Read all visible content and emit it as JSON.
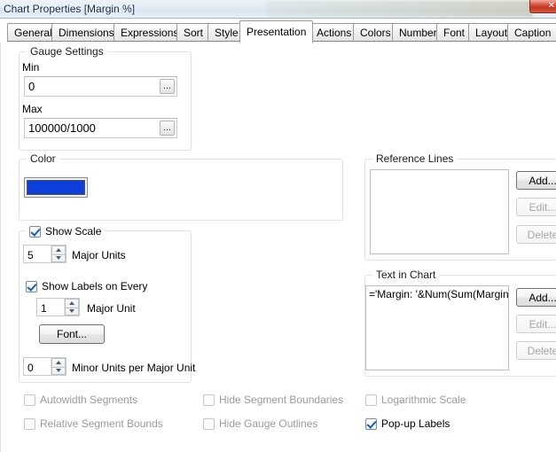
{
  "window": {
    "title": "Chart Properties [Margin %]",
    "close_label": "✕"
  },
  "tabs": [
    {
      "label": "General",
      "active": false
    },
    {
      "label": "Dimensions",
      "active": false
    },
    {
      "label": "Expressions",
      "active": false
    },
    {
      "label": "Sort",
      "active": false
    },
    {
      "label": "Style",
      "active": false
    },
    {
      "label": "Presentation",
      "active": true
    },
    {
      "label": "Actions",
      "active": false
    },
    {
      "label": "Colors",
      "active": false
    },
    {
      "label": "Number",
      "active": false
    },
    {
      "label": "Font",
      "active": false
    },
    {
      "label": "Layout",
      "active": false
    },
    {
      "label": "Caption",
      "active": false
    }
  ],
  "gauge_settings": {
    "title": "Gauge Settings",
    "min_label": "Min",
    "min_value": "0",
    "max_label": "Max",
    "max_value": "100000/1000",
    "ellipsis_label": "..."
  },
  "color_group": {
    "title": "Color",
    "swatch_color": "#0d3fdb"
  },
  "scale_group": {
    "show_scale_label": "Show Scale",
    "show_scale_checked": true,
    "major_units_value": "5",
    "major_units_label": "Major Units",
    "show_labels_label": "Show Labels on Every",
    "show_labels_checked": true,
    "major_unit_value": "1",
    "major_unit_label": "Major Unit",
    "font_button_label": "Font...",
    "minor_units_value": "0",
    "minor_units_label": "Minor Units per Major Unit"
  },
  "reference_lines": {
    "title": "Reference Lines",
    "items": [],
    "add_label": "Add...",
    "edit_label": "Edit...",
    "delete_label": "Delete"
  },
  "text_in_chart": {
    "title": "Text in Chart",
    "items": [
      "='Margin: '&Num(Sum(Margin) / S"
    ],
    "add_label": "Add...",
    "edit_label": "Edit...",
    "delete_label": "Delete"
  },
  "bottom_options": {
    "autowidth_segments": {
      "label": "Autowidth Segments",
      "checked": false,
      "enabled": false
    },
    "relative_segment_bounds": {
      "label": "Relative Segment Bounds",
      "checked": false,
      "enabled": false
    },
    "hide_segment_boundaries": {
      "label": "Hide Segment Boundaries",
      "checked": false,
      "enabled": false
    },
    "hide_gauge_outlines": {
      "label": "Hide Gauge Outlines",
      "checked": false,
      "enabled": false
    },
    "logarithmic_scale": {
      "label": "Logarithmic Scale",
      "checked": false,
      "enabled": false
    },
    "popup_labels": {
      "label": "Pop-up Labels",
      "checked": true,
      "enabled": true
    }
  }
}
